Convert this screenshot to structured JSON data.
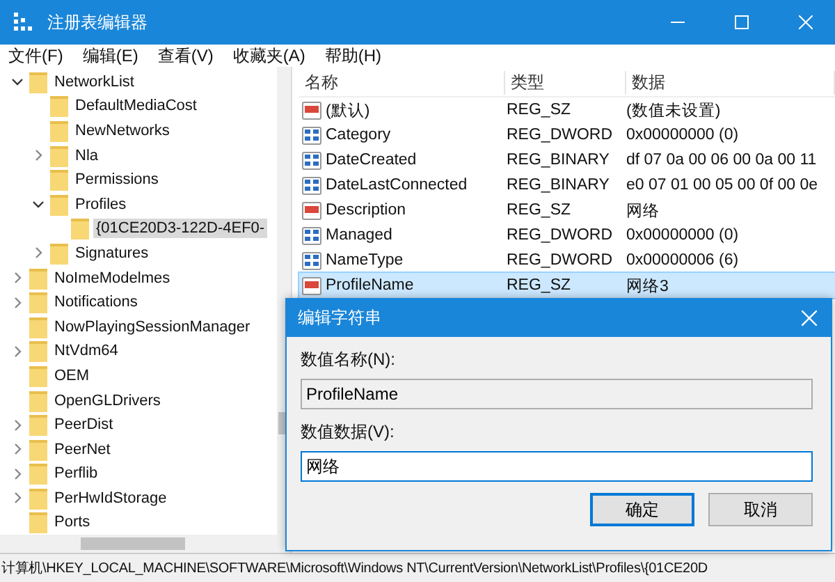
{
  "window": {
    "title": "注册表编辑器"
  },
  "menu": [
    "文件(F)",
    "编辑(E)",
    "查看(V)",
    "收藏夹(A)",
    "帮助(H)"
  ],
  "tree": [
    {
      "label": "NetworkList",
      "expanded": true,
      "selected": false,
      "children": [
        {
          "label": "DefaultMediaCost",
          "selected": false
        },
        {
          "label": "NewNetworks",
          "selected": false
        },
        {
          "label": "Nla",
          "expanded": false,
          "selected": false
        },
        {
          "label": "Permissions",
          "selected": false
        },
        {
          "label": "Profiles",
          "expanded": true,
          "selected": false,
          "children": [
            {
              "label": "{01CE20D3-122D-4EF0-",
              "selected": true
            }
          ]
        },
        {
          "label": "Signatures",
          "expanded": false,
          "selected": false
        }
      ]
    },
    {
      "label": "NoImeModelmes",
      "expanded": false,
      "selected": false
    },
    {
      "label": "Notifications",
      "expanded": false,
      "selected": false
    },
    {
      "label": "NowPlayingSessionManager",
      "selected": false
    },
    {
      "label": "NtVdm64",
      "expanded": false,
      "selected": false
    },
    {
      "label": "OEM",
      "selected": false
    },
    {
      "label": "OpenGLDrivers",
      "selected": false
    },
    {
      "label": "PeerDist",
      "expanded": false,
      "selected": false
    },
    {
      "label": "PeerNet",
      "expanded": false,
      "selected": false
    },
    {
      "label": "Perflib",
      "expanded": false,
      "selected": false
    },
    {
      "label": "PerHwIdStorage",
      "expanded": false,
      "selected": false
    },
    {
      "label": "Ports",
      "selected": false
    }
  ],
  "table": {
    "columns": [
      "名称",
      "类型",
      "数据"
    ],
    "rows": [
      {
        "kind": "string",
        "name": "(默认)",
        "type": "REG_SZ",
        "data": "(数值未设置)",
        "selected": false
      },
      {
        "kind": "binary",
        "name": "Category",
        "type": "REG_DWORD",
        "data": "0x00000000 (0)",
        "selected": false
      },
      {
        "kind": "binary",
        "name": "DateCreated",
        "type": "REG_BINARY",
        "data": "df 07 0a 00 06 00 0a 00 11",
        "selected": false
      },
      {
        "kind": "binary",
        "name": "DateLastConnected",
        "type": "REG_BINARY",
        "data": "e0 07 01 00 05 00 0f 00 0e",
        "selected": false
      },
      {
        "kind": "string",
        "name": "Description",
        "type": "REG_SZ",
        "data": "网络",
        "selected": false
      },
      {
        "kind": "binary",
        "name": "Managed",
        "type": "REG_DWORD",
        "data": "0x00000000 (0)",
        "selected": false
      },
      {
        "kind": "binary",
        "name": "NameType",
        "type": "REG_DWORD",
        "data": "0x00000006 (6)",
        "selected": false
      },
      {
        "kind": "string",
        "name": "ProfileName",
        "type": "REG_SZ",
        "data": "网络3",
        "selected": true
      }
    ]
  },
  "status_bar": "计算机\\HKEY_LOCAL_MACHINE\\SOFTWARE\\Microsoft\\Windows NT\\CurrentVersion\\NetworkList\\Profiles\\{01CE20D",
  "dialog": {
    "title": "编辑字符串",
    "name_label": "数值名称(N):",
    "name_value": "ProfileName",
    "data_label": "数值数据(V):",
    "data_value": "网络",
    "buttons": [
      "确定",
      "取消"
    ]
  }
}
